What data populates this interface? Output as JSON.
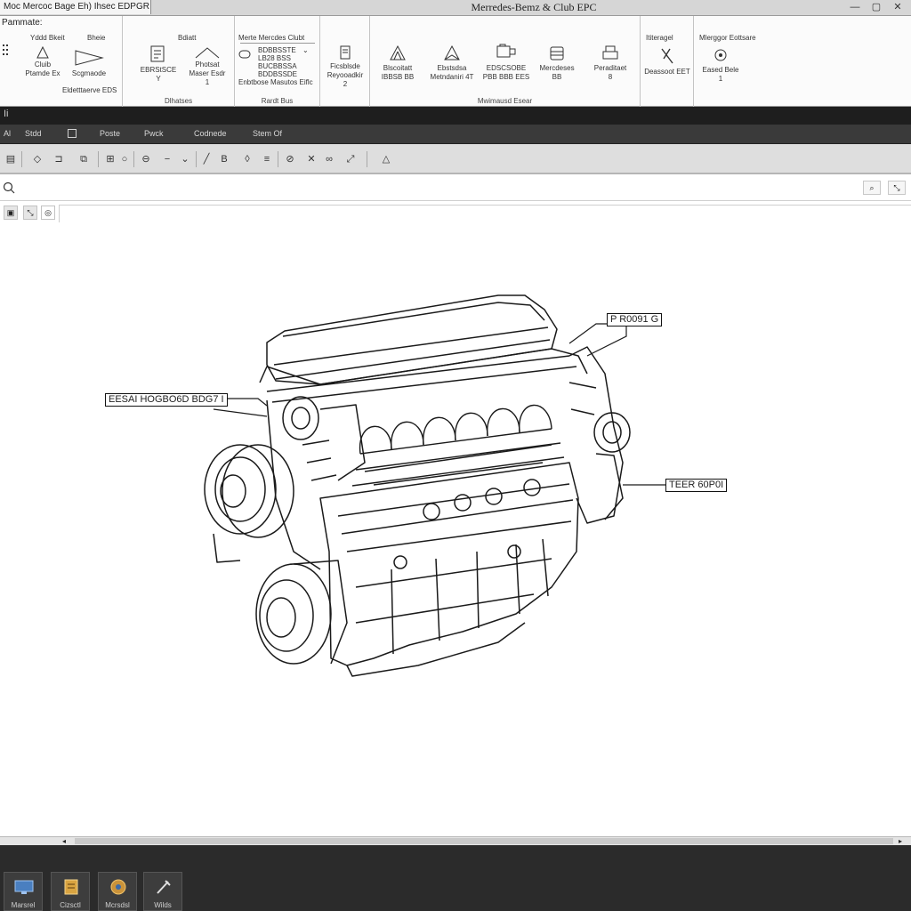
{
  "window": {
    "doc_tab": "Moc Mercoc Bage Eh)   Ihsec EDPGR",
    "title": "Merredes-Bemz & Club EPC"
  },
  "ribbon": {
    "left_panel_title": "Pammate:",
    "groups": [
      {
        "label": "",
        "buttons": [
          {
            "label": "Yddd Bkeit"
          },
          {
            "label": "Bheie"
          },
          {
            "label": "Cluib\nPtamde Ex"
          },
          {
            "label": "Scgmaode"
          },
          {
            "label": "Eldetttaerve EDS"
          }
        ]
      },
      {
        "label": "Dlhatses",
        "buttons": [
          {
            "label": "Bdiatt"
          },
          {
            "label": "EBRStSCE\nY"
          },
          {
            "label": "Photsat\nMaser Esdr\n1"
          }
        ]
      },
      {
        "label": "Rardt Bus",
        "title": "Merte Mercdes Clubt",
        "list_lines": [
          "BDBBSSTE",
          "LB28 BSS",
          "BUCBBSSA",
          "BDDBSSDE"
        ],
        "footer": "Enbtbose Masutos Eiflc"
      },
      {
        "label": "",
        "buttons": [
          {
            "label": "Ficsblsde\nReyooadkir\n2"
          }
        ]
      },
      {
        "label": "Mwimausd Esear",
        "buttons": [
          {
            "label": "Blscoitatt\nIBBSB BB"
          },
          {
            "label": "Ebstsdsa\nMetndaniri 4T"
          },
          {
            "label": "EDSCSOBE\nPBB BBB EES"
          },
          {
            "label": "Mercdeses\nBB"
          },
          {
            "label": "Peraditaet\n8"
          }
        ]
      },
      {
        "label": "",
        "title": "Ititeragel",
        "buttons": [
          {
            "label": "Deassoot EET"
          }
        ]
      },
      {
        "label": "",
        "title": "Mlerggor Eottsare",
        "buttons": [
          {
            "label": "Eased Bele\n1"
          }
        ]
      }
    ]
  },
  "dark_band": {
    "glyph": "Ii"
  },
  "menubar": {
    "items": [
      "Al",
      "Stdd",
      "",
      "Poste",
      "Pwck",
      "Codnede",
      "Stem Of"
    ]
  },
  "search": {
    "value": "",
    "placeholder": ""
  },
  "canvas": {
    "callouts": [
      {
        "text": "P R0091 G"
      },
      {
        "text": "EESAI HOGBO6D BDG7 I"
      },
      {
        "text": "TEER 60P0I"
      }
    ]
  },
  "taskbar": {
    "items": [
      {
        "label": "Marsrel"
      },
      {
        "label": "Cizsctl"
      },
      {
        "label": "Mcrsdsl"
      },
      {
        "label": "Wilds"
      }
    ]
  },
  "colors": {
    "titlebar": "#d6d6d6",
    "menubar": "#3a3a3a",
    "toolbar": "#dedede",
    "taskbar": "#2b2b2b",
    "drawing_line": "#1a1a1a"
  }
}
